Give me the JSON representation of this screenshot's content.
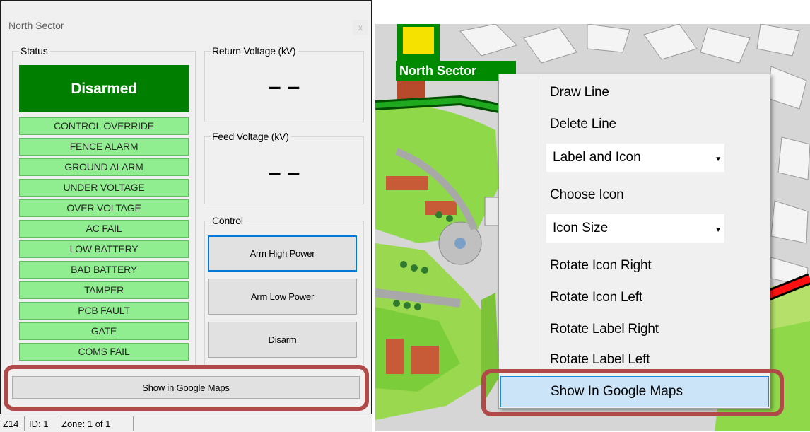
{
  "dialog": {
    "title": "North Sector",
    "close_glyph": "x",
    "status": {
      "label": "Status",
      "state": "Disarmed",
      "alarms": [
        "CONTROL OVERRIDE",
        "FENCE ALARM",
        "GROUND ALARM",
        "UNDER VOLTAGE",
        "OVER VOLTAGE",
        "AC FAIL",
        "LOW BATTERY",
        "BAD BATTERY",
        "TAMPER",
        "PCB FAULT",
        "GATE",
        "COMS FAIL"
      ]
    },
    "return_voltage": {
      "label": "Return Voltage  (kV)",
      "value": "– –"
    },
    "feed_voltage": {
      "label": "Feed Voltage  (kV)",
      "value": "– –"
    },
    "control": {
      "label": "Control",
      "arm_high": "Arm High Power",
      "arm_low": "Arm Low Power",
      "disarm": "Disarm"
    },
    "maps_button": "Show in Google Maps",
    "statusbar": {
      "zone_code": "Z14",
      "id": "ID: 1",
      "zone": "Zone: 1 of 1"
    }
  },
  "map": {
    "sector_label": "North Sector",
    "context_menu": {
      "draw_line": "Draw Line",
      "delete_line": "Delete Line",
      "label_mode": "Label and Icon",
      "choose_icon": "Choose Icon",
      "icon_size": "Icon Size",
      "rotate_icon_right": "Rotate Icon Right",
      "rotate_icon_left": "Rotate Icon Left",
      "rotate_label_right": "Rotate Label Right",
      "rotate_label_left": "Rotate Label Left",
      "show_in_maps": "Show In Google Maps"
    }
  },
  "colors": {
    "armed_state_bg": "#007e00",
    "alarm_ok_bg": "#90ee90",
    "callout": "#b04a48",
    "menu_highlight": "#cce4f7",
    "menu_highlight_border": "#1e88d9"
  },
  "icons": [
    "close-icon",
    "dropdown-arrow-icon",
    "sector-device-icon"
  ]
}
